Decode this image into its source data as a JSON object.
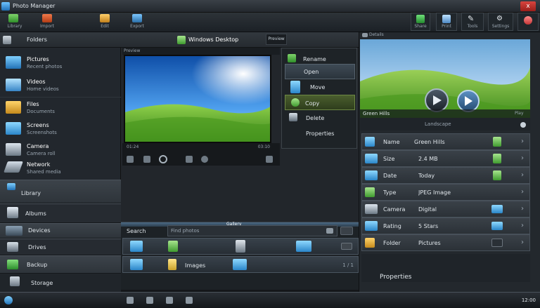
{
  "window": {
    "title": "Photo Manager",
    "close_label": "x"
  },
  "toolbar": {
    "items": [
      {
        "label": "Library",
        "icon": "folder-icon"
      },
      {
        "label": "Import",
        "icon": "import-icon"
      },
      {
        "label": "Edit",
        "icon": "edit-icon"
      },
      {
        "label": "Export",
        "icon": "export-icon"
      }
    ],
    "right_items": [
      {
        "label": "Share",
        "icon": "share-icon"
      },
      {
        "label": "Print",
        "icon": "print-icon"
      },
      {
        "label": "Tools",
        "icon": "tools-icon"
      },
      {
        "label": "Settings",
        "icon": "settings-icon"
      }
    ]
  },
  "sidebar": {
    "header": "Folders",
    "items": [
      {
        "title": "Pictures",
        "sub": "Recent photos",
        "icon": "pictures-icon"
      },
      {
        "title": "Videos",
        "sub": "Home videos",
        "icon": "videos-icon"
      },
      {
        "title": "Files",
        "sub": "Documents",
        "icon": "files-icon"
      },
      {
        "title": "Screens",
        "sub": "Screenshots",
        "icon": "screens-icon"
      },
      {
        "title": "Camera",
        "sub": "Camera roll",
        "icon": "camera-icon"
      },
      {
        "title": "Network",
        "sub": "Shared media",
        "icon": "network-icon"
      }
    ],
    "bands": [
      {
        "label": "Library",
        "icon": "library-icon"
      },
      {
        "label": "Albums",
        "icon": "albums-icon"
      },
      {
        "label": "Devices",
        "icon": "devices-icon"
      },
      {
        "label": "Drives",
        "icon": "drives-icon"
      },
      {
        "label": "Backup",
        "icon": "backup-icon"
      }
    ],
    "footer": "Storage"
  },
  "center": {
    "title": "Windows Desktop",
    "tab_label": "Preview",
    "preview_label": "Preview",
    "ctrl_left": "01:24",
    "ctrl_right": "03:10"
  },
  "context_menu": {
    "items": [
      "Rename",
      "Open",
      "Move",
      "Copy",
      "Delete",
      "Properties"
    ]
  },
  "bottom_panel": {
    "header": "Gallery",
    "search_label": "Search",
    "search_placeholder": "Find photos",
    "page_indicator": "1 / 1",
    "row_label": "Images"
  },
  "right_panel": {
    "header": "Details",
    "image_caption": "Green Hills",
    "image_sub": "Landscape",
    "play_label": "Play",
    "rows": [
      {
        "label": "Name",
        "value": "Green Hills"
      },
      {
        "label": "Size",
        "value": "2.4 MB"
      },
      {
        "label": "Date",
        "value": "Today"
      },
      {
        "label": "Type",
        "value": "JPEG Image"
      },
      {
        "label": "Camera",
        "value": "Digital"
      },
      {
        "label": "Rating",
        "value": "5 Stars"
      },
      {
        "label": "Folder",
        "value": "Pictures"
      }
    ],
    "footer": "Properties"
  },
  "taskbar": {
    "clock": "12:00"
  },
  "colors": {
    "accent": "#4aa3df",
    "sky": "#2f7fd8",
    "grass": "#5fb12b"
  }
}
